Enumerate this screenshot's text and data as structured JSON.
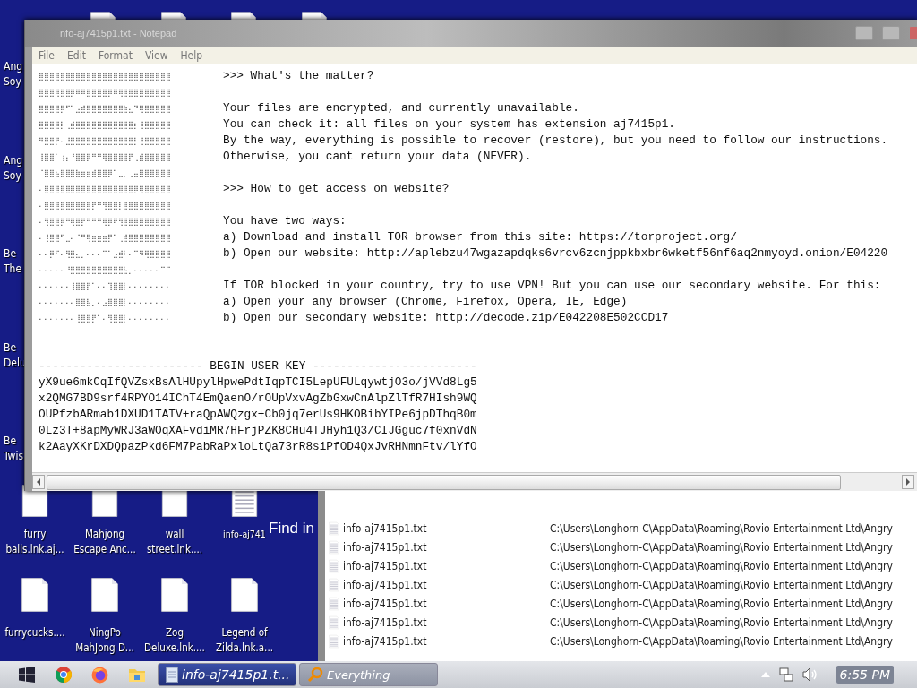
{
  "desktop": {
    "left_icons": [
      {
        "label": "Ang Soy"
      },
      {
        "label": "Ang Soy"
      },
      {
        "label": "Be The"
      },
      {
        "label": "Be Delu"
      },
      {
        "label": "Be Twis"
      }
    ],
    "top_icons": [
      {
        "kind": "blank"
      },
      {
        "kind": "blank"
      },
      {
        "kind": "blank"
      },
      {
        "kind": "blank"
      }
    ],
    "icons": [
      {
        "label": "furry balls.lnk.aj...",
        "kind": "blank"
      },
      {
        "label": "Mahjong Escape Anc...",
        "kind": "blank"
      },
      {
        "label": "wall street.lnk....",
        "kind": "blank"
      },
      {
        "label": "info-aj741",
        "kind": "text"
      },
      {
        "label": "furrycucks....",
        "kind": "blank"
      },
      {
        "label": "NingPo MahJong D...",
        "kind": "blank"
      },
      {
        "label": "Zog Deluxe.lnk....",
        "kind": "blank"
      },
      {
        "label": "Legend of Zilda.lnk.a...",
        "kind": "blank"
      }
    ],
    "overlay_text": "Find in"
  },
  "notepad": {
    "title": "nfo-aj7415p1.txt - Notepad",
    "menu": [
      "File",
      "Edit",
      "Format",
      "View",
      "Help"
    ],
    "lines": [
      {
        "art": "⣿⣿⣿⣿⣿⣿⣿⣿⣿⣿⣿⣿⣿⣿⣿⣿⣿⣿⣿⣿⣿⣿⣿⣿⣿",
        "text": ">>> What's the matter?"
      },
      {
        "art": "⣿⣿⣿⢿⣿⣿⡿⠿⠿⣿⣿⣿⣿⡿⠿⢿⣿⣿⣿⣿⣿⣿⣿⣿⣿"
      },
      {
        "art": "⣿⣿⣿⣿⡿⠋⠁⣠⣾⣿⣿⣿⣿⣿⣿⣿⣷⣄⠙⢿⣿⣿⣿⣿⣿",
        "text": "Your files are encrypted, and currently unavailable."
      },
      {
        "art": "⣿⣿⣿⣿⡇⢀⣾⣿⣿⣿⣿⣿⣿⣿⣿⣿⣿⣿⡆⢸⣿⣿⣿⣿⣿",
        "text": "You can check it: all files on your system has extension aj7415p1."
      },
      {
        "art": "⠻⣿⣿⡟⠄⣸⣿⣿⣿⣿⣿⣿⣿⣿⣿⣿⣿⣿⡇⢸⣿⣿⣿⣿⣿",
        "text": "By the way, everything is possible to recover (restore), but you need to follow our instructions."
      },
      {
        "art": "⢸⣿⣿⠁⢰⡄⠘⣿⣿⡿⠛⠛⢿⣿⣿⣿⣿⡟⢀⣾⣿⣿⣿⣿⣿",
        "text": "Otherwise, you cant return your data (NEVER)."
      },
      {
        "art": "⠈⣿⣿⣦⣿⣿⣿⣷⣶⣶⣾⣿⣿⡿⠁⣀⡀⢀⣤⣿⣿⣿⣿⣿⣿"
      },
      {
        "art": "⠄⣿⣿⣿⣿⣿⣿⣿⣿⣿⣿⣿⣿⣿⣿⣿⣿⣿⡿⢿⣿⣿⣿⣿⣿",
        "text": ">>> How to get access on website?"
      },
      {
        "art": "⠄⣿⣿⣿⣿⣿⣿⣿⣿⣿⡟⠛⢻⣿⣿⡇⣿⣿⣿⣿⣿⣿⣿⣿⣿"
      },
      {
        "art": "⠄⢻⣿⣿⡿⠛⢿⣿⡟⠛⠛⠛⢿⡿⠟⢻⣿⣿⣿⣿⣿⣿⣿⣿⣿",
        "text": "You have two ways:"
      },
      {
        "art": "⠄⢸⣿⣿⠋⣀⠄⠈⠛⢿⣶⣶⣶⡟⠁⢀⣾⣿⣿⣿⣿⣿⣿⣿⣿",
        "text": "a) Download and install TOR browser from this site: https://torproject.org/"
      },
      {
        "art": "⠄⠄⡿⠋⠄⢻⣿⣄⡀⠄⠄⠄⠉⠁⣠⣾⠇⠄⠉⠻⢿⣿⣿⣿⣿",
        "text": "b) Open our website: http://aplebzu47wgazapdqks6vrcv6zcnjppkbxbr6wketf56nf6aq2nmyoyd.onion/E04220"
      },
      {
        "art": "⠄⠄⠄⠄⠄⠘⣿⣿⣿⣿⣿⣿⣿⣿⣿⣿⣧⡀⠄⠄⠄⠄⠄⠉⠉"
      },
      {
        "art": "⠄⠄⠄⠄⠄⠄⢸⣿⣿⡟⠁⠄⠄⢹⣿⣿⡇⠄⠄⠄⠄⠄⠄⠄⠄",
        "text": "If TOR blocked in your country, try to use VPN! But you can use our secondary website. For this:"
      },
      {
        "art": "⠄⠄⠄⠄⠄⠄⠄⣿⣿⣧⡀⠄⣠⣿⣿⣿⡇⠄⠄⠄⠄⠄⠄⠄⠄",
        "text": "a) Open your any browser (Chrome, Firefox, Opera, IE, Edge)"
      },
      {
        "art": "⠄⠄⠄⠄⠄⠄⠄⢸⣿⣿⡟⠁⠄⢻⣿⣿⡇⠄⠄⠄⠄⠄⠄⠄⠄",
        "text": "b) Open our secondary website: http://decode.zip/E042208E502CCD17"
      }
    ],
    "key_header": "------------------------ BEGIN USER KEY ------------------------",
    "key_lines": [
      "yX9ue6mkCqIfQVZsxBsAlHUpylHpwePdtIqpTCI5LepUFULqywtjO3o/jVVd8Lg5",
      "x2QMG7BD9srf4RPYO14IChT4EmQaenO/rOUpVxvAgZbGxwCnAlpZlTfR7HIsh9WQ",
      "OUPfzbARmab1DXUD1TATV+raQpAWQzgx+Cb0jq7erUs9HKOBibYIPe6jpDThqB0m",
      "0Lz3T+8apMyWRJ3aWOqXAFvdiMR7HFrjPZK8CHu4TJHyh1Q3/CIJGguc7f0xnVdN",
      "k2AayXKrDXDQpazPkd6FM7PabRaPxloLtQa73rR8siPfOD4QxJvRHNmnFtv/lYfO"
    ]
  },
  "everything": {
    "rows": [
      {
        "name": "info-aj7415p1.txt",
        "path": "C:\\Users\\Longhorn-C\\AppData\\Roaming\\Rovio Entertainment Ltd\\Angry"
      },
      {
        "name": "info-aj7415p1.txt",
        "path": "C:\\Users\\Longhorn-C\\AppData\\Roaming\\Rovio Entertainment Ltd\\Angry"
      },
      {
        "name": "info-aj7415p1.txt",
        "path": "C:\\Users\\Longhorn-C\\AppData\\Roaming\\Rovio Entertainment Ltd\\Angry"
      },
      {
        "name": "info-aj7415p1.txt",
        "path": "C:\\Users\\Longhorn-C\\AppData\\Roaming\\Rovio Entertainment Ltd\\Angry"
      },
      {
        "name": "info-aj7415p1.txt",
        "path": "C:\\Users\\Longhorn-C\\AppData\\Roaming\\Rovio Entertainment Ltd\\Angry"
      },
      {
        "name": "info-aj7415p1.txt",
        "path": "C:\\Users\\Longhorn-C\\AppData\\Roaming\\Rovio Entertainment Ltd\\Angry"
      },
      {
        "name": "info-aj7415p1.txt",
        "path": "C:\\Users\\Longhorn-C\\AppData\\Roaming\\Rovio Entertainment Ltd\\Angry"
      }
    ]
  },
  "taskbar": {
    "apps": [
      {
        "kind": "start"
      },
      {
        "kind": "chrome"
      },
      {
        "kind": "firefox"
      },
      {
        "kind": "folder"
      }
    ],
    "windows": [
      {
        "label": "info-aj7415p1.t...",
        "kind": "notepad",
        "selected": true
      },
      {
        "label": "Everything",
        "kind": "search",
        "selected": false
      }
    ],
    "clock": "6:55 PM"
  }
}
